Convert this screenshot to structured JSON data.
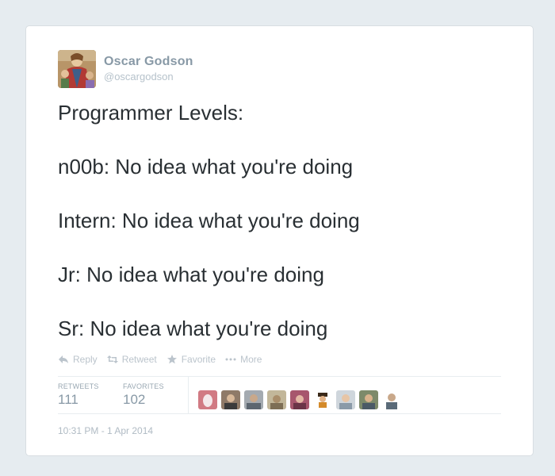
{
  "author": {
    "full_name": "Oscar Godson",
    "screen_name": "@oscargodson"
  },
  "tweet": {
    "lines": [
      "Programmer Levels:",
      "n00b: No idea what you're doing",
      "Intern: No idea what you're doing",
      "Jr: No idea what you're doing",
      "Sr: No idea what you're doing"
    ]
  },
  "actions": {
    "reply": "Reply",
    "retweet": "Retweet",
    "favorite": "Favorite",
    "more": "More"
  },
  "stats": {
    "retweets_label": "RETWEETS",
    "retweets_count": "111",
    "favorites_label": "FAVORITES",
    "favorites_count": "102"
  },
  "favoriters": [
    "egg-avatar",
    "user-avatar-2",
    "user-avatar-3",
    "user-avatar-4",
    "user-avatar-5",
    "user-avatar-6",
    "user-avatar-7",
    "user-avatar-8",
    "user-avatar-9"
  ],
  "timestamp": "10:31 PM - 1 Apr 2014",
  "colors": {
    "background": "#e6ecf0",
    "card": "#ffffff",
    "text": "#292f33",
    "muted": "#8899a6",
    "egg": "#d17a83"
  }
}
